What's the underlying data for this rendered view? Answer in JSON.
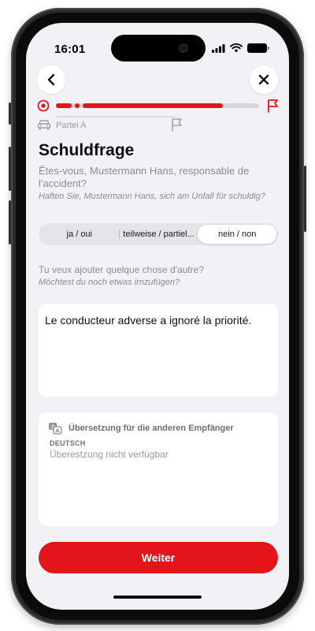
{
  "status_bar": {
    "time": "16:01"
  },
  "nav": {
    "back_icon": "chevron-left-icon",
    "close_icon": "close-icon"
  },
  "progress": {
    "fraction": 0.82,
    "start_icon": "target-icon",
    "end_icon": "flag-icon",
    "accent_color": "#e3151b"
  },
  "party": {
    "label": "Partei A",
    "icon": "car-icon",
    "flag_icon": "flag-icon"
  },
  "question": {
    "title": "Schuldfrage",
    "fr": "Êtes-vous, Mustermann Hans, responsable de l'accident?",
    "de": "Haften Sie, Mustermann Hans, sich am Unfall für schuldig?"
  },
  "answer": {
    "options": [
      "ja / oui",
      "teilweise / partiel...",
      "nein / non"
    ],
    "selected": "nein / non"
  },
  "additional": {
    "prompt_fr": "Tu veux ajouter quelque chose d'autre?",
    "prompt_de": "Möchtest du noch etwas irnzufügen?",
    "value": "Le conducteur adverse a ignoré la priorité."
  },
  "translation": {
    "header": "Übersetzung für die anderen Empfänger",
    "icon": "translate-icon",
    "language": "DEUTSCH",
    "text": "Überestzung nicht verfügbar"
  },
  "actions": {
    "continue_label": "Weiter"
  }
}
